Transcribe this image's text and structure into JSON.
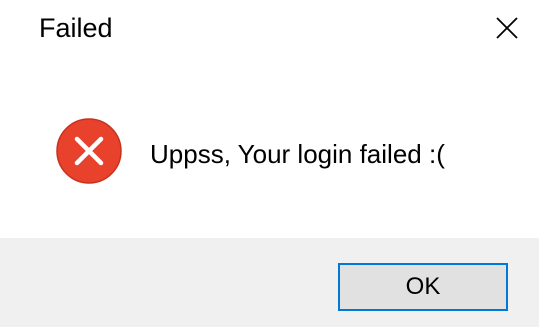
{
  "dialog": {
    "title": "Failed",
    "message": "Uppss, Your login failed :(",
    "ok_label": "OK",
    "icons": {
      "close": "close-icon",
      "error": "error-icon"
    },
    "colors": {
      "error_red": "#e8412c",
      "button_border": "#0078d7",
      "footer_bg": "#f0f0f0"
    }
  }
}
